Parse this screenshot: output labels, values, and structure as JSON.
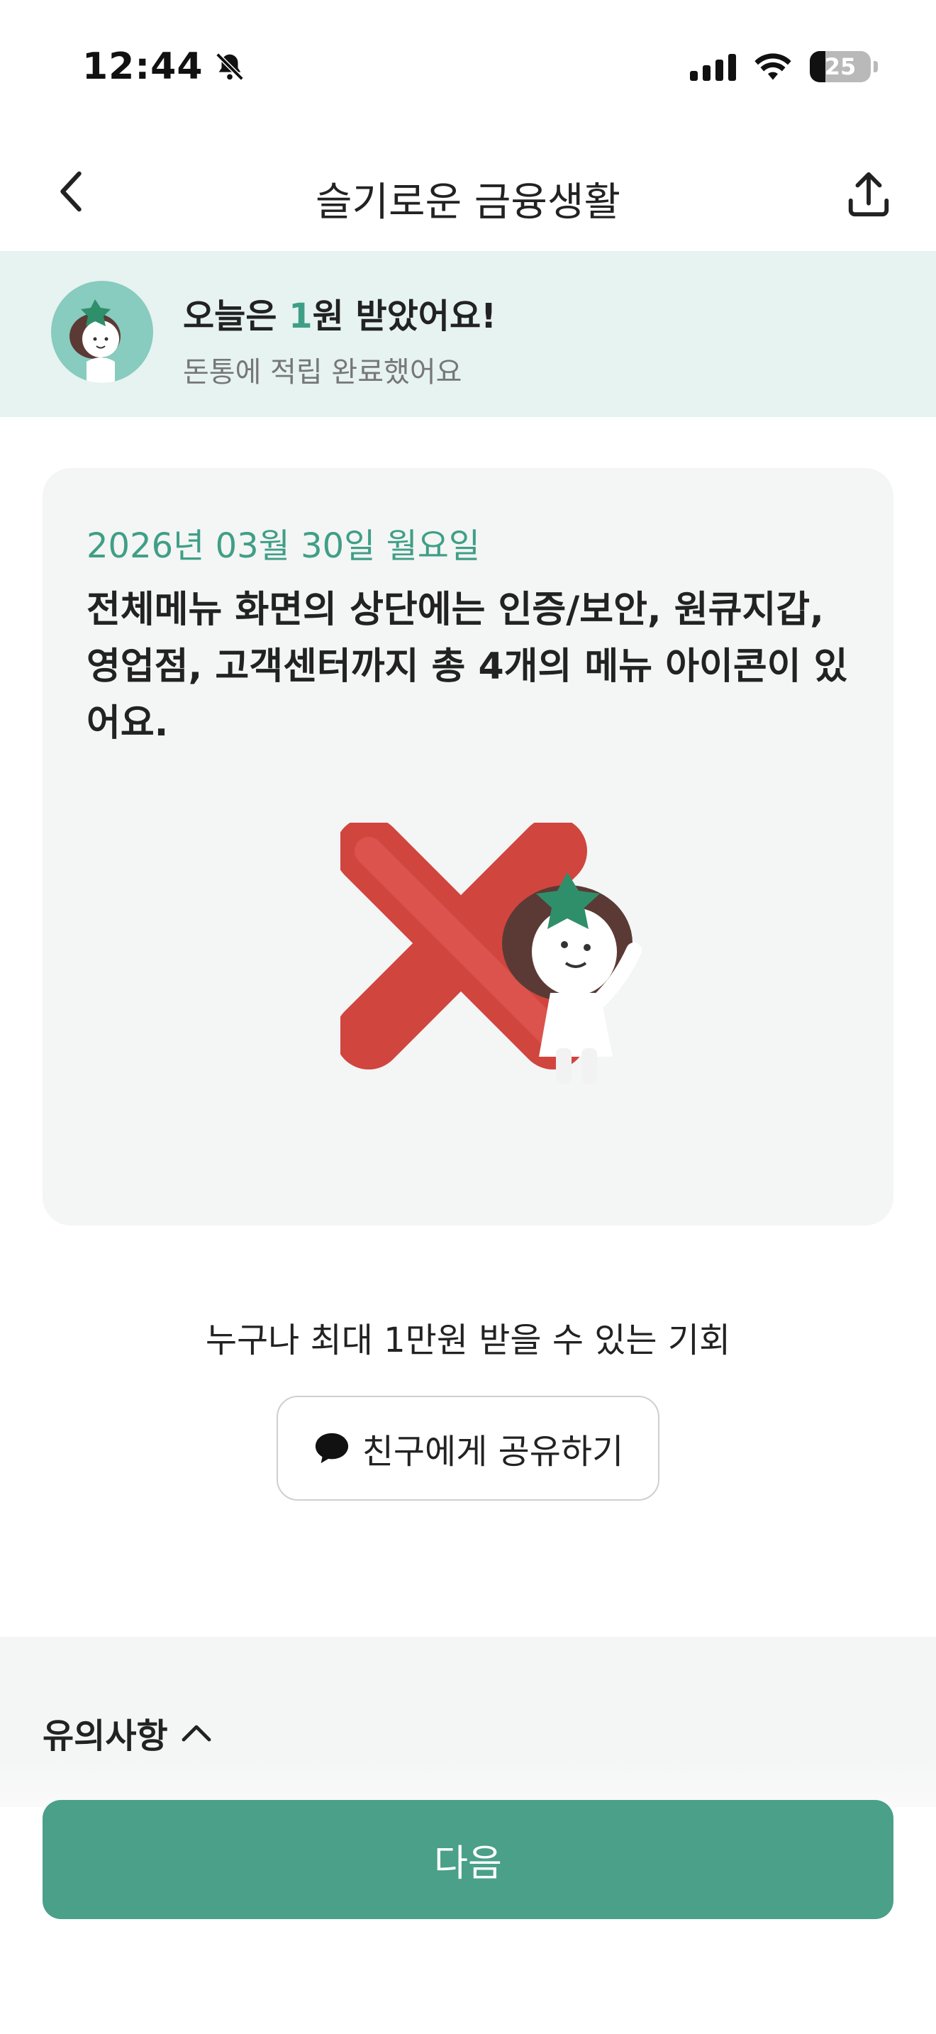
{
  "status_bar": {
    "time": "12:44",
    "battery_level": "25",
    "icons": [
      "bell-slash-icon",
      "cellular-signal-icon",
      "wifi-icon",
      "battery-icon"
    ]
  },
  "nav": {
    "title": "슬기로운 금융생활",
    "back_icon": "chevron-left-icon",
    "share_icon": "share-upload-icon"
  },
  "banner": {
    "title_prefix": "오늘은 ",
    "title_amount": "1",
    "title_suffix": "원 받았어요!",
    "subtitle": "돈통에 적립 완료했어요",
    "accent_color": "#3f9f86"
  },
  "card": {
    "date": "2026년 03월 30일 월요일",
    "question": "전체메뉴 화면의 상단에는 인증/보안, 원큐지갑, 영업점, 고객센터까지 총 4개의 메뉴 아이콘이 있어요.",
    "answer_icon": "x-mark-icon"
  },
  "promo": {
    "text": "누구나 최대 1만원 받을 수 있는 기회",
    "share_button_label": "친구에게 공유하기",
    "share_button_icon": "chat-bubble-icon"
  },
  "notice": {
    "label": "유의사항",
    "toggle_icon": "chevron-up-icon"
  },
  "next_button": {
    "label": "다음",
    "color": "#4aa088"
  }
}
